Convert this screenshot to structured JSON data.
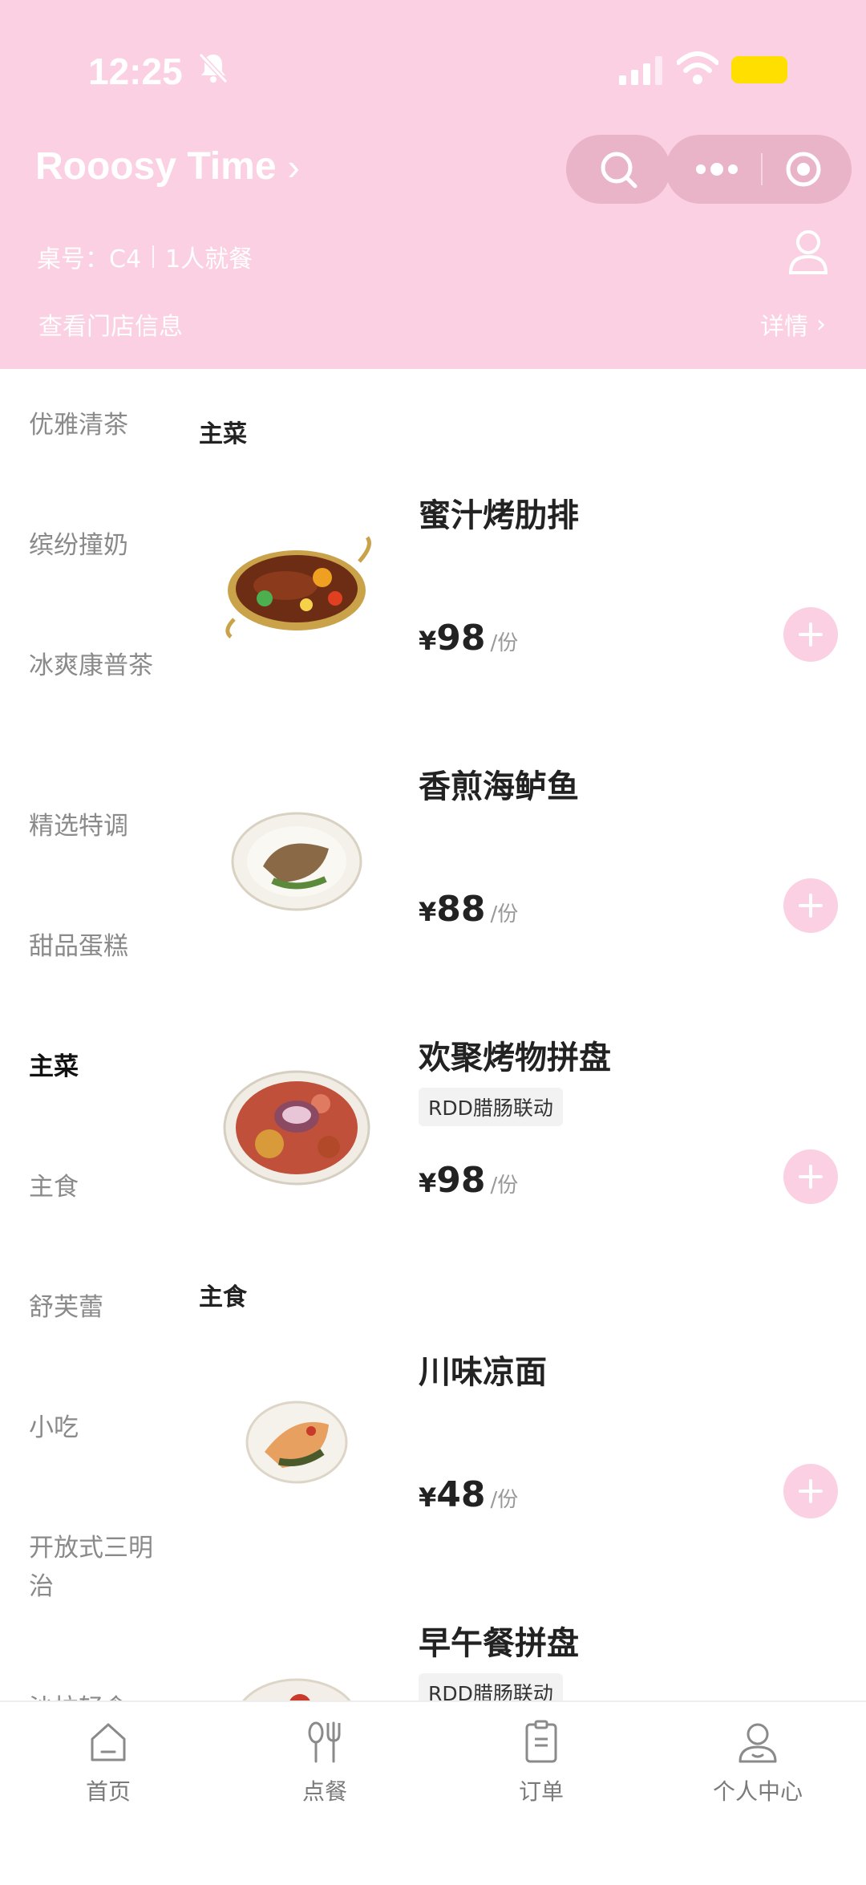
{
  "status_bar": {
    "time": "12:25"
  },
  "header": {
    "shop_name": "Rooosy Time",
    "table_label": "桌号：C4",
    "diners": "1人就餐",
    "store_info": "查看门店信息",
    "detail": "详情"
  },
  "categories": [
    {
      "label": "优雅清茶"
    },
    {
      "label": "缤纷撞奶"
    },
    {
      "label": "冰爽康普茶"
    },
    {
      "label": "精选特调"
    },
    {
      "label": "甜品蛋糕"
    },
    {
      "label": "主菜"
    },
    {
      "label": "主食"
    },
    {
      "label": "舒芙蕾"
    },
    {
      "label": "小吃"
    },
    {
      "label": "开放式三明治"
    },
    {
      "label": "沙拉轻食"
    }
  ],
  "sections": [
    {
      "title": "主菜"
    },
    {
      "title": "主食"
    }
  ],
  "dishes": [
    {
      "name": "蜜汁烤肋排",
      "tag": "",
      "currency": "¥",
      "price": "98",
      "unit": "/份"
    },
    {
      "name": "香煎海鲈鱼",
      "tag": "",
      "currency": "¥",
      "price": "88",
      "unit": "/份"
    },
    {
      "name": "欢聚烤物拼盘",
      "tag": "RDD腊肠联动",
      "currency": "¥",
      "price": "98",
      "unit": "/份"
    },
    {
      "name": "川味凉面",
      "tag": "",
      "currency": "¥",
      "price": "48",
      "unit": "/份"
    },
    {
      "name": "早午餐拼盘",
      "tag": "RDD腊肠联动",
      "currency": "¥",
      "price": "",
      "unit": ""
    }
  ],
  "bottom_nav": [
    {
      "label": "首页",
      "icon": "home-icon"
    },
    {
      "label": "点餐",
      "icon": "cutlery-icon"
    },
    {
      "label": "订单",
      "icon": "order-icon"
    },
    {
      "label": "个人中心",
      "icon": "profile-icon"
    }
  ],
  "colors": {
    "header_bg": "#fbd0e2",
    "add_button": "#fbd0e2",
    "battery": "#ffdf00"
  }
}
